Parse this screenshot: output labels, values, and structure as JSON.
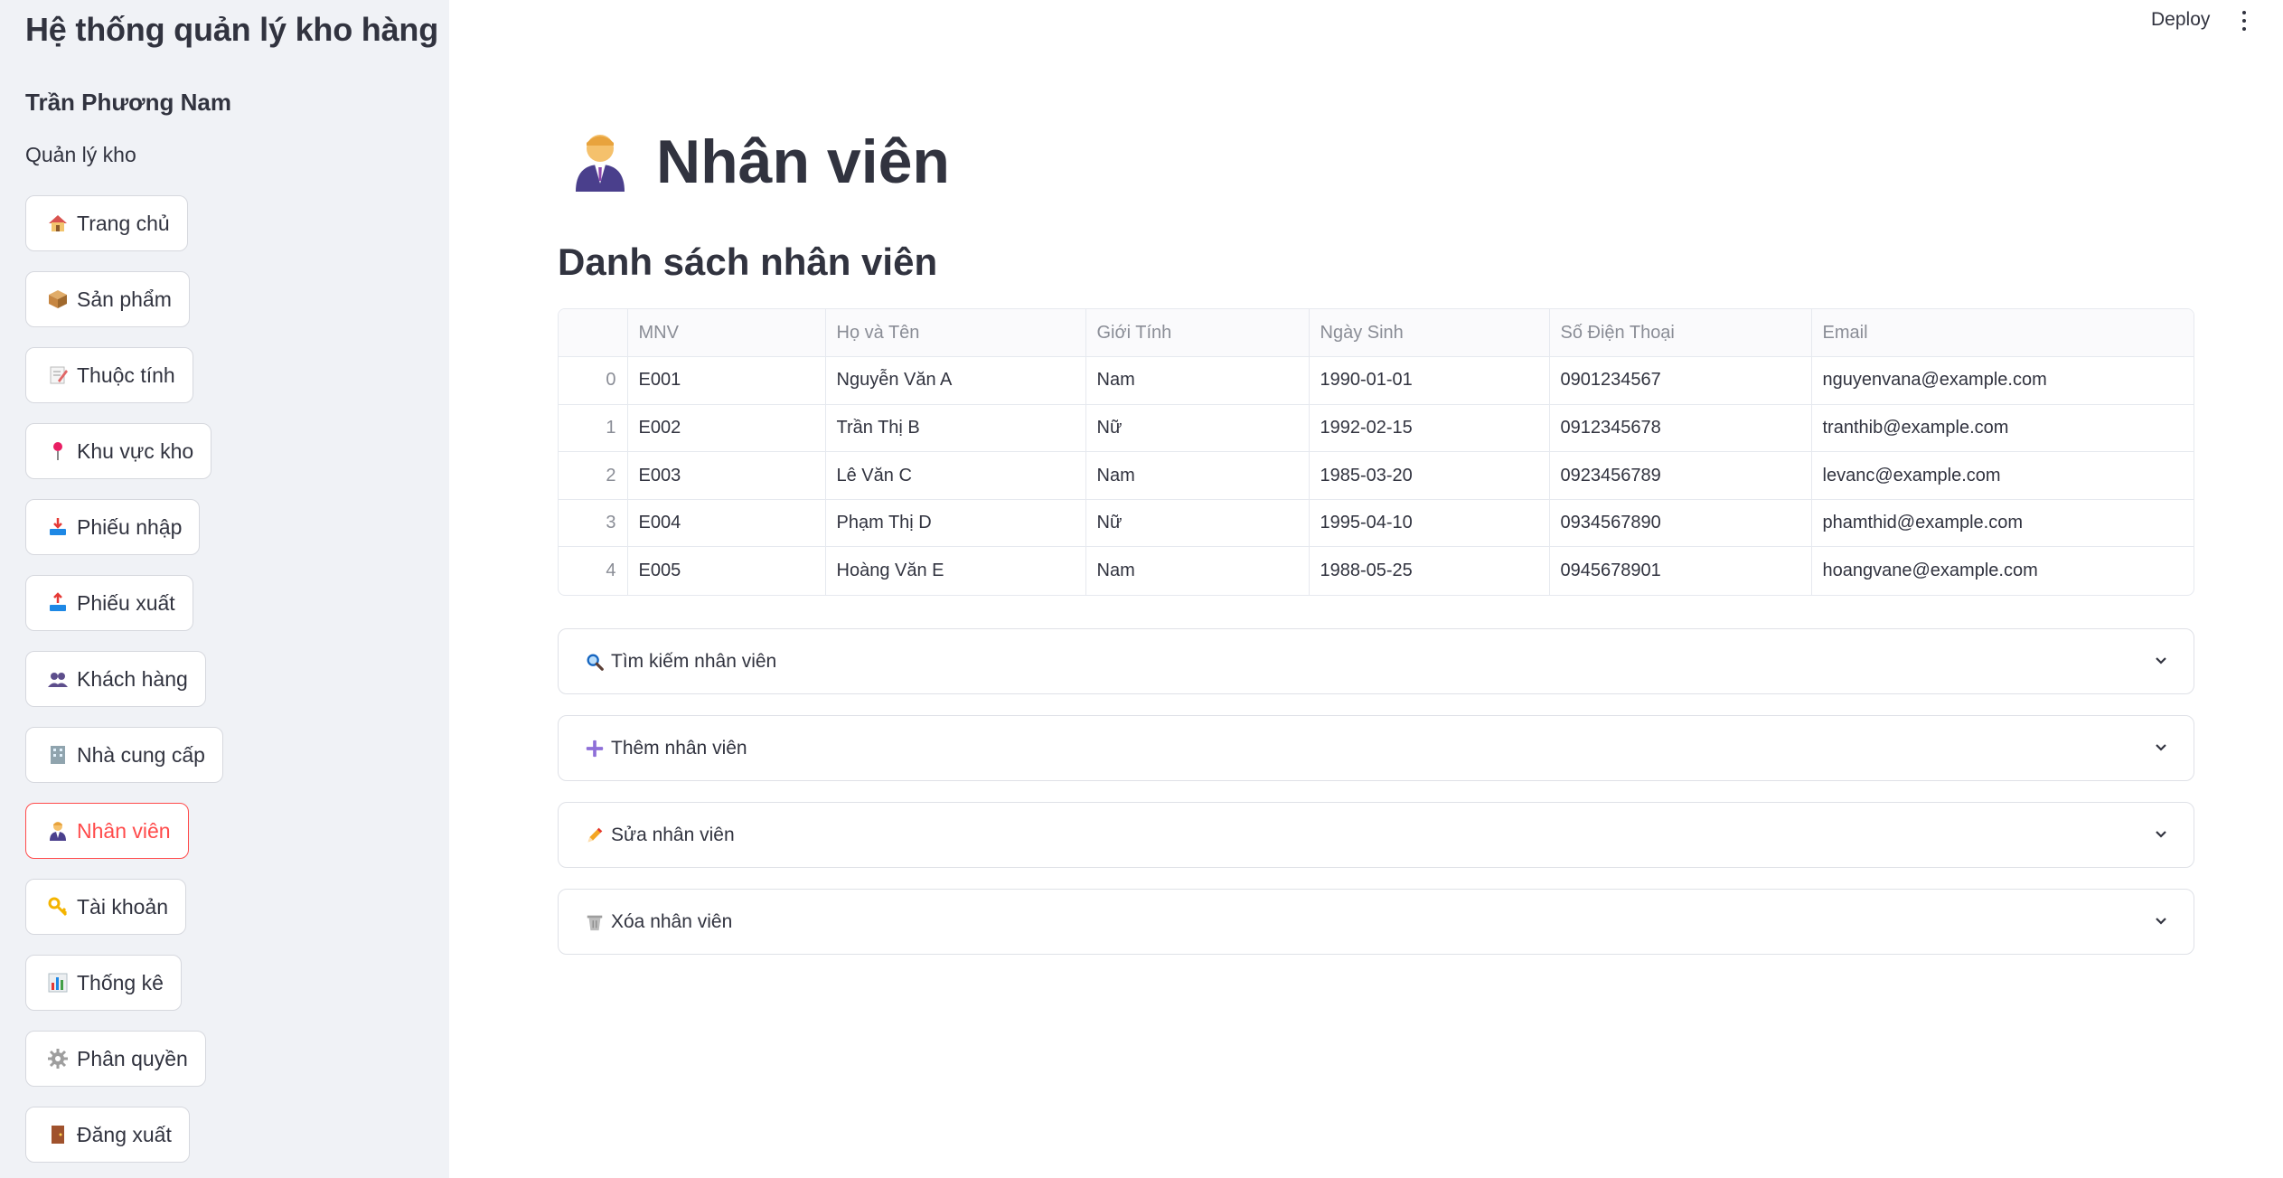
{
  "sidebar": {
    "app_title": "Hệ thống quản lý kho hàng",
    "user_name": "Trần Phương Nam",
    "user_role": "Quản lý kho",
    "items": [
      {
        "label": "Trang chủ",
        "icon": "house-icon"
      },
      {
        "label": "Sản phẩm",
        "icon": "package-icon"
      },
      {
        "label": "Thuộc tính",
        "icon": "memo-icon"
      },
      {
        "label": "Khu vực kho",
        "icon": "pin-icon"
      },
      {
        "label": "Phiếu nhập",
        "icon": "inbox-tray-icon"
      },
      {
        "label": "Phiếu xuất",
        "icon": "outbox-tray-icon"
      },
      {
        "label": "Khách hàng",
        "icon": "people-icon"
      },
      {
        "label": "Nhà cung cấp",
        "icon": "office-building-icon"
      },
      {
        "label": "Nhân viên",
        "icon": "office-worker-icon",
        "active": true
      },
      {
        "label": "Tài khoản",
        "icon": "key-icon"
      },
      {
        "label": "Thống kê",
        "icon": "bar-chart-icon"
      },
      {
        "label": "Phân quyền",
        "icon": "gear-icon"
      },
      {
        "label": "Đăng xuất",
        "icon": "door-icon"
      }
    ]
  },
  "topbar": {
    "deploy_label": "Deploy"
  },
  "main": {
    "title": "Nhân viên",
    "section_title": "Danh sách nhân viên",
    "table": {
      "columns": [
        "",
        "MNV",
        "Họ và Tên",
        "Giới Tính",
        "Ngày Sinh",
        "Số Điện Thoại",
        "Email"
      ],
      "rows": [
        [
          "0",
          "E001",
          "Nguyễn Văn A",
          "Nam",
          "1990-01-01",
          "0901234567",
          "nguyenvana@example.com"
        ],
        [
          "1",
          "E002",
          "Trần Thị B",
          "Nữ",
          "1992-02-15",
          "0912345678",
          "tranthib@example.com"
        ],
        [
          "2",
          "E003",
          "Lê Văn C",
          "Nam",
          "1985-03-20",
          "0923456789",
          "levanc@example.com"
        ],
        [
          "3",
          "E004",
          "Phạm Thị D",
          "Nữ",
          "1995-04-10",
          "0934567890",
          "phamthid@example.com"
        ],
        [
          "4",
          "E005",
          "Hoàng Văn E",
          "Nam",
          "1988-05-25",
          "0945678901",
          "hoangvane@example.com"
        ]
      ]
    },
    "expanders": [
      {
        "label": "Tìm kiếm nhân viên",
        "icon": "magnifier-icon"
      },
      {
        "label": "Thêm nhân viên",
        "icon": "plus-icon"
      },
      {
        "label": "Sửa nhân viên",
        "icon": "pencil-icon"
      },
      {
        "label": "Xóa nhân viên",
        "icon": "wastebasket-icon"
      }
    ]
  },
  "colors": {
    "accent": "#ff4b4b",
    "sidebar_bg": "#f0f2f6",
    "text": "#31333f"
  }
}
